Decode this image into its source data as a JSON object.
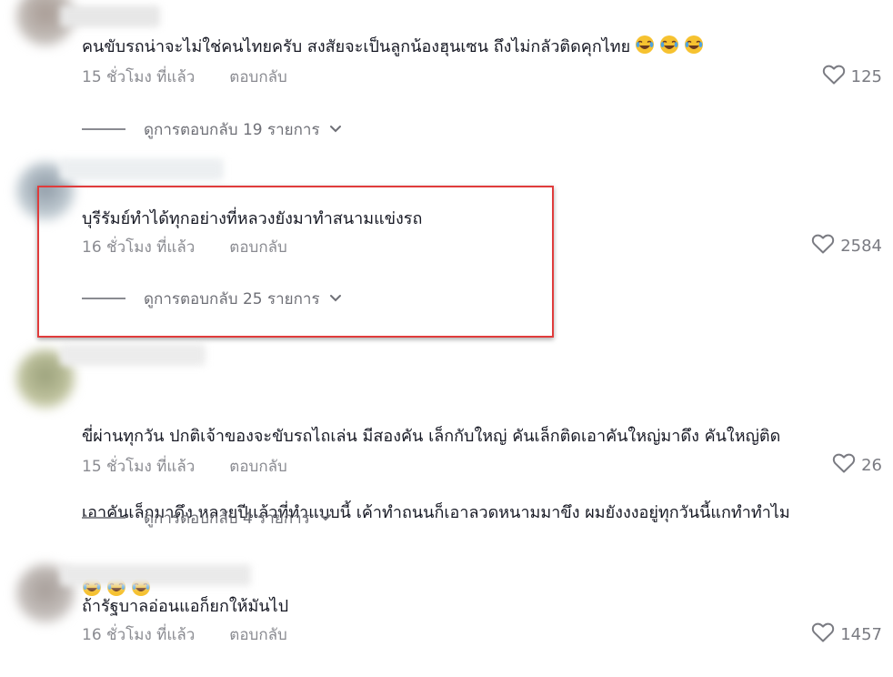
{
  "comments": [
    {
      "text": "คนขับรถน่าจะไม่ใช่คนไทยครับ สงสัยจะเป็นลูกน้องฮุนเซน ถึงไม่กลัวติดคุกไทย",
      "emoji": [
        "laughing-face-icon",
        "laughing-face-icon",
        "laughing-face-icon"
      ],
      "time": "15 ชั่วโมง ที่แล้ว",
      "reply_label": "ตอบกลับ",
      "likes": "125",
      "view_replies": "ดูการตอบกลับ 19 รายการ"
    },
    {
      "text": "บุรีรัมย์ทำได้ทุกอย่างที่หลวงยังมาทำสนามแข่งรถ",
      "time": "16 ชั่วโมง ที่แล้ว",
      "reply_label": "ตอบกลับ",
      "likes": "2584",
      "view_replies": "ดูการตอบกลับ 25 รายการ"
    },
    {
      "text_line1": "ขี่ผ่านทุกวัน ปกติเจ้าของจะขับรถไถเล่น มีสองคัน เล็กกับใหญ่ คันเล็กติดเอาคันใหญ่มาดึง คันใหญ่ติด",
      "text_line2": "เอาคันเล็กมาดึง หลายปีแล้วที่ทำแบบนี้ เค้าทำถนนก็เอาลวดหนามมาขึง ผมยังงงอยู่ทุกวันนี้แกทำทำไม",
      "emoji": [
        "laughing-face-icon",
        "laughing-face-icon",
        "laughing-face-icon"
      ],
      "time": "15 ชั่วโมง ที่แล้ว",
      "reply_label": "ตอบกลับ",
      "likes": "26",
      "view_replies": "ดูการตอบกลับ 4 รายการ"
    },
    {
      "text": "ถ้ารัฐบาลอ่อนแอก็ยกให้มันไป",
      "time": "16 ชั่วโมง ที่แล้ว",
      "reply_label": "ตอบกลับ",
      "likes": "1457"
    }
  ],
  "colors": {
    "text": "#161823",
    "meta": "#8a8b91",
    "highlight": "#e03c3c",
    "emoji_face": "#f6c230"
  }
}
